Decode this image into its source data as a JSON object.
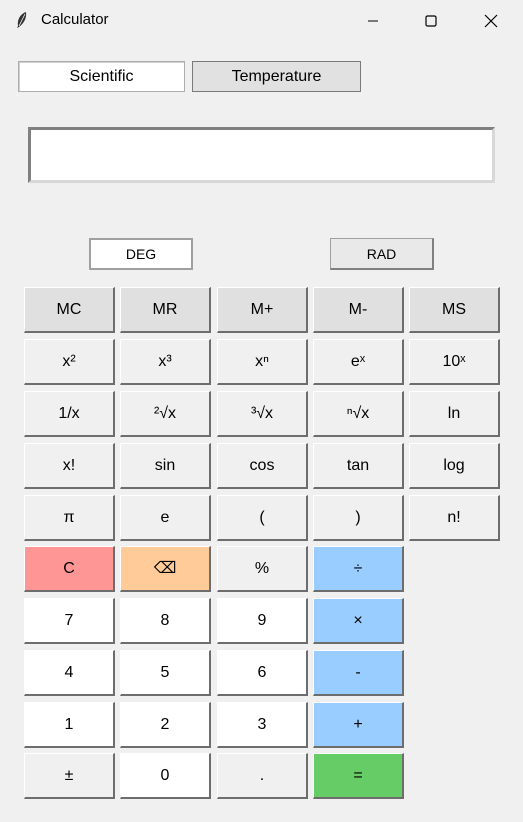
{
  "window": {
    "title": "Calculator",
    "icon": "feather-icon"
  },
  "tabs": [
    {
      "label": "Scientific",
      "active": true
    },
    {
      "label": "Temperature",
      "active": false
    }
  ],
  "display": {
    "value": ""
  },
  "angle_modes": [
    {
      "label": "DEG",
      "active": true
    },
    {
      "label": "RAD",
      "active": false
    }
  ],
  "colors": {
    "memory": "#e0e0e0",
    "function": "#f0f0f0",
    "digit": "#ffffff",
    "clear": "#ff9696",
    "backspace": "#ffcc99",
    "operator": "#99ccff",
    "equals": "#66cc66"
  },
  "rows": [
    [
      "MC",
      "MR",
      "M+",
      "M-",
      "MS"
    ],
    [
      "x²",
      "x³",
      "xⁿ",
      "eˣ",
      "10ˣ"
    ],
    [
      "1/x",
      "²√x",
      "³√x",
      "ⁿ√x",
      "ln"
    ],
    [
      "x!",
      "sin",
      "cos",
      "tan",
      "log"
    ],
    [
      "π",
      "e",
      "(",
      ")",
      "n!"
    ],
    [
      "C",
      "⌫",
      "%",
      "÷"
    ],
    [
      "7",
      "8",
      "9",
      "×"
    ],
    [
      "4",
      "5",
      "6",
      "-"
    ],
    [
      "1",
      "2",
      "3",
      "+"
    ],
    [
      "±",
      "0",
      ".",
      "="
    ]
  ]
}
